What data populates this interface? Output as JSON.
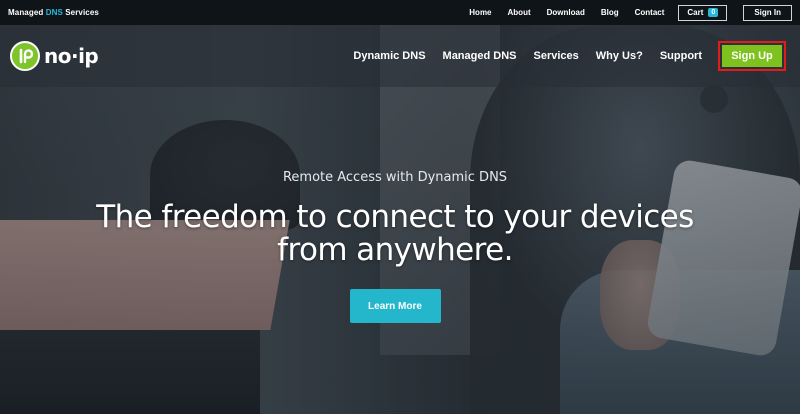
{
  "topbar": {
    "tagline_prefix": "Managed ",
    "tagline_accent": "DNS",
    "tagline_suffix": " Services",
    "links": [
      "Home",
      "About",
      "Download",
      "Blog",
      "Contact"
    ],
    "cart_label": "Cart",
    "cart_count": "0",
    "signin_label": "Sign In"
  },
  "nav": {
    "logo_text": "no·ip",
    "links": [
      "Dynamic DNS",
      "Managed DNS",
      "Services",
      "Why Us?",
      "Support"
    ],
    "signup_label": "Sign Up"
  },
  "hero": {
    "subtitle": "Remote Access with Dynamic DNS",
    "title_line1": "The freedom to connect to your devices",
    "title_line2": "from anywhere.",
    "cta_label": "Learn More"
  },
  "colors": {
    "accent_blue": "#2ab8d8",
    "brand_green": "#7dc21e",
    "highlight_red": "#e21b1b",
    "cta_teal": "#24b7cc"
  }
}
